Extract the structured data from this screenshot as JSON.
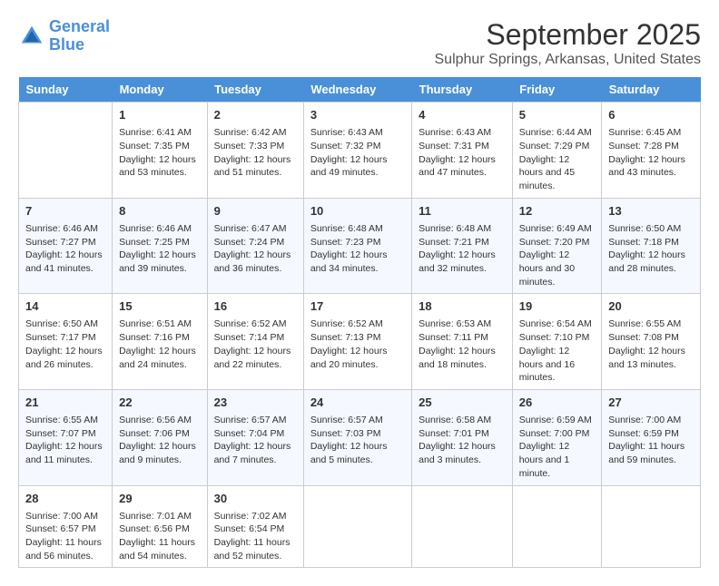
{
  "header": {
    "logo_line1": "General",
    "logo_line2": "Blue",
    "title": "September 2025",
    "subtitle": "Sulphur Springs, Arkansas, United States"
  },
  "columns": [
    "Sunday",
    "Monday",
    "Tuesday",
    "Wednesday",
    "Thursday",
    "Friday",
    "Saturday"
  ],
  "weeks": [
    [
      {
        "num": "",
        "sunrise": "",
        "sunset": "",
        "daylight": ""
      },
      {
        "num": "1",
        "sunrise": "Sunrise: 6:41 AM",
        "sunset": "Sunset: 7:35 PM",
        "daylight": "Daylight: 12 hours and 53 minutes."
      },
      {
        "num": "2",
        "sunrise": "Sunrise: 6:42 AM",
        "sunset": "Sunset: 7:33 PM",
        "daylight": "Daylight: 12 hours and 51 minutes."
      },
      {
        "num": "3",
        "sunrise": "Sunrise: 6:43 AM",
        "sunset": "Sunset: 7:32 PM",
        "daylight": "Daylight: 12 hours and 49 minutes."
      },
      {
        "num": "4",
        "sunrise": "Sunrise: 6:43 AM",
        "sunset": "Sunset: 7:31 PM",
        "daylight": "Daylight: 12 hours and 47 minutes."
      },
      {
        "num": "5",
        "sunrise": "Sunrise: 6:44 AM",
        "sunset": "Sunset: 7:29 PM",
        "daylight": "Daylight: 12 hours and 45 minutes."
      },
      {
        "num": "6",
        "sunrise": "Sunrise: 6:45 AM",
        "sunset": "Sunset: 7:28 PM",
        "daylight": "Daylight: 12 hours and 43 minutes."
      }
    ],
    [
      {
        "num": "7",
        "sunrise": "Sunrise: 6:46 AM",
        "sunset": "Sunset: 7:27 PM",
        "daylight": "Daylight: 12 hours and 41 minutes."
      },
      {
        "num": "8",
        "sunrise": "Sunrise: 6:46 AM",
        "sunset": "Sunset: 7:25 PM",
        "daylight": "Daylight: 12 hours and 39 minutes."
      },
      {
        "num": "9",
        "sunrise": "Sunrise: 6:47 AM",
        "sunset": "Sunset: 7:24 PM",
        "daylight": "Daylight: 12 hours and 36 minutes."
      },
      {
        "num": "10",
        "sunrise": "Sunrise: 6:48 AM",
        "sunset": "Sunset: 7:23 PM",
        "daylight": "Daylight: 12 hours and 34 minutes."
      },
      {
        "num": "11",
        "sunrise": "Sunrise: 6:48 AM",
        "sunset": "Sunset: 7:21 PM",
        "daylight": "Daylight: 12 hours and 32 minutes."
      },
      {
        "num": "12",
        "sunrise": "Sunrise: 6:49 AM",
        "sunset": "Sunset: 7:20 PM",
        "daylight": "Daylight: 12 hours and 30 minutes."
      },
      {
        "num": "13",
        "sunrise": "Sunrise: 6:50 AM",
        "sunset": "Sunset: 7:18 PM",
        "daylight": "Daylight: 12 hours and 28 minutes."
      }
    ],
    [
      {
        "num": "14",
        "sunrise": "Sunrise: 6:50 AM",
        "sunset": "Sunset: 7:17 PM",
        "daylight": "Daylight: 12 hours and 26 minutes."
      },
      {
        "num": "15",
        "sunrise": "Sunrise: 6:51 AM",
        "sunset": "Sunset: 7:16 PM",
        "daylight": "Daylight: 12 hours and 24 minutes."
      },
      {
        "num": "16",
        "sunrise": "Sunrise: 6:52 AM",
        "sunset": "Sunset: 7:14 PM",
        "daylight": "Daylight: 12 hours and 22 minutes."
      },
      {
        "num": "17",
        "sunrise": "Sunrise: 6:52 AM",
        "sunset": "Sunset: 7:13 PM",
        "daylight": "Daylight: 12 hours and 20 minutes."
      },
      {
        "num": "18",
        "sunrise": "Sunrise: 6:53 AM",
        "sunset": "Sunset: 7:11 PM",
        "daylight": "Daylight: 12 hours and 18 minutes."
      },
      {
        "num": "19",
        "sunrise": "Sunrise: 6:54 AM",
        "sunset": "Sunset: 7:10 PM",
        "daylight": "Daylight: 12 hours and 16 minutes."
      },
      {
        "num": "20",
        "sunrise": "Sunrise: 6:55 AM",
        "sunset": "Sunset: 7:08 PM",
        "daylight": "Daylight: 12 hours and 13 minutes."
      }
    ],
    [
      {
        "num": "21",
        "sunrise": "Sunrise: 6:55 AM",
        "sunset": "Sunset: 7:07 PM",
        "daylight": "Daylight: 12 hours and 11 minutes."
      },
      {
        "num": "22",
        "sunrise": "Sunrise: 6:56 AM",
        "sunset": "Sunset: 7:06 PM",
        "daylight": "Daylight: 12 hours and 9 minutes."
      },
      {
        "num": "23",
        "sunrise": "Sunrise: 6:57 AM",
        "sunset": "Sunset: 7:04 PM",
        "daylight": "Daylight: 12 hours and 7 minutes."
      },
      {
        "num": "24",
        "sunrise": "Sunrise: 6:57 AM",
        "sunset": "Sunset: 7:03 PM",
        "daylight": "Daylight: 12 hours and 5 minutes."
      },
      {
        "num": "25",
        "sunrise": "Sunrise: 6:58 AM",
        "sunset": "Sunset: 7:01 PM",
        "daylight": "Daylight: 12 hours and 3 minutes."
      },
      {
        "num": "26",
        "sunrise": "Sunrise: 6:59 AM",
        "sunset": "Sunset: 7:00 PM",
        "daylight": "Daylight: 12 hours and 1 minute."
      },
      {
        "num": "27",
        "sunrise": "Sunrise: 7:00 AM",
        "sunset": "Sunset: 6:59 PM",
        "daylight": "Daylight: 11 hours and 59 minutes."
      }
    ],
    [
      {
        "num": "28",
        "sunrise": "Sunrise: 7:00 AM",
        "sunset": "Sunset: 6:57 PM",
        "daylight": "Daylight: 11 hours and 56 minutes."
      },
      {
        "num": "29",
        "sunrise": "Sunrise: 7:01 AM",
        "sunset": "Sunset: 6:56 PM",
        "daylight": "Daylight: 11 hours and 54 minutes."
      },
      {
        "num": "30",
        "sunrise": "Sunrise: 7:02 AM",
        "sunset": "Sunset: 6:54 PM",
        "daylight": "Daylight: 11 hours and 52 minutes."
      },
      {
        "num": "",
        "sunrise": "",
        "sunset": "",
        "daylight": ""
      },
      {
        "num": "",
        "sunrise": "",
        "sunset": "",
        "daylight": ""
      },
      {
        "num": "",
        "sunrise": "",
        "sunset": "",
        "daylight": ""
      },
      {
        "num": "",
        "sunrise": "",
        "sunset": "",
        "daylight": ""
      }
    ]
  ]
}
